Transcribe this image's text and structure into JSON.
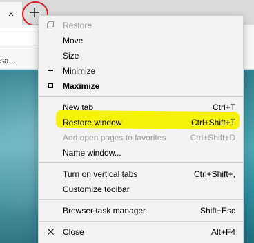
{
  "browser": {
    "tab_close": "×",
    "favorites_fragment": "sa..."
  },
  "menu": {
    "window_items": [
      {
        "label": "Restore",
        "disabled": true
      },
      {
        "label": "Move"
      },
      {
        "label": "Size"
      },
      {
        "label": "Minimize"
      },
      {
        "label": "Maximize"
      }
    ],
    "tab_items": [
      {
        "label": "New tab",
        "shortcut": "Ctrl+T"
      },
      {
        "label": "Restore window",
        "shortcut": "Ctrl+Shift+T",
        "highlighted": true
      },
      {
        "label": "Add open pages to favorites",
        "shortcut": "Ctrl+Shift+D",
        "disabled": true
      },
      {
        "label": "Name window..."
      }
    ],
    "toolbar_items": [
      {
        "label": "Turn on vertical tabs",
        "shortcut": "Ctrl+Shift+,"
      },
      {
        "label": "Customize toolbar"
      }
    ],
    "manager_item": {
      "label": "Browser task manager",
      "shortcut": "Shift+Esc"
    },
    "close_item": {
      "label": "Close",
      "shortcut": "Alt+F4"
    }
  },
  "colors": {
    "annotation_circle": "#d4202a",
    "highlighter": "#f6f20a"
  }
}
